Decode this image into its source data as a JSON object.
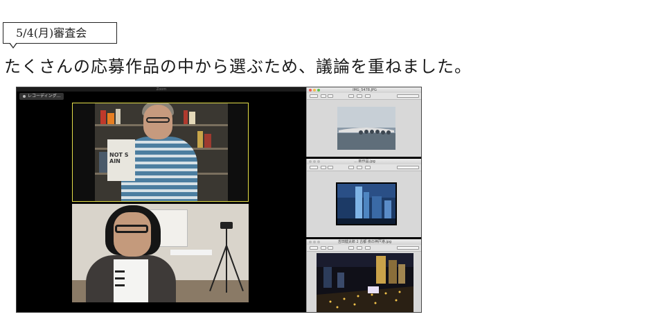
{
  "caption": {
    "date_label": "5/4(月)審査会",
    "headline": "たくさんの応募作品の中から選ぶため、議論を重ねました。"
  },
  "zoom": {
    "window_title": "Zoom",
    "recording_label": "レコーディング...",
    "participants": [
      {
        "name": "participant-top",
        "active_speaker": true
      },
      {
        "name": "participant-bottom",
        "active_speaker": false
      }
    ],
    "bag_text": "NOT S\nAIN"
  },
  "viewers": [
    {
      "title": "IMG_5478.JPG",
      "photo_desc": "bridge-photo"
    },
    {
      "title": "... 新作品.jpg",
      "photo_desc": "city-tower-photo"
    },
    {
      "title": "吉田健太郎 2 古都 夜の神戸港.jpg",
      "photo_desc": "night-cityscape-photo"
    }
  ],
  "colors": {
    "active_speaker_border": "#e6e04a",
    "mac_close": "#ec5f58",
    "mac_min": "#f3bd4f",
    "mac_max": "#5fc253"
  }
}
